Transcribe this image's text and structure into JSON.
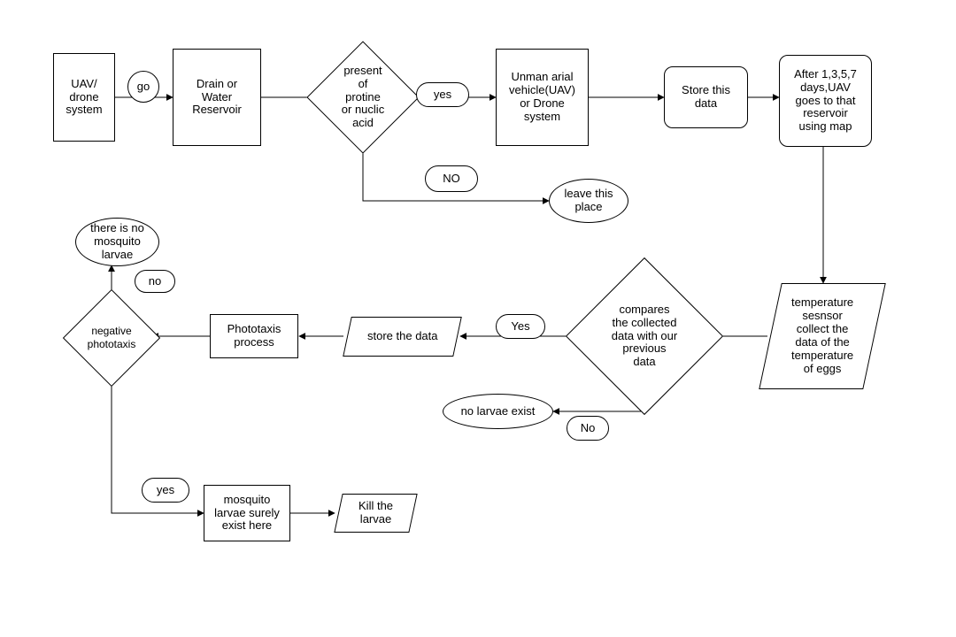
{
  "diagram": {
    "type": "flowchart",
    "nodes": {
      "uav_drone_system": "UAV/\ndrone\nsystem",
      "go": "go",
      "drain": "Drain or\nWater\nReservoir",
      "present_decision": "present\nof\nprotine\nor nuclic\nacid",
      "yes1": "yes",
      "no1": "NO",
      "uav2": "Unman arial\nvehicle(UAV)\nor Drone\nsystem",
      "store1": "Store this\ndata",
      "schedule": "After 1,3,5,7\ndays,UAV\ngoes to that\nreservoir\nusing map",
      "leave": "leave this\nplace",
      "temp_sensor": "temperature\nsesnsor\ncollect the\ndata of the\ntemperature\nof eggs",
      "compare_decision": "compares\nthe collected\ndata with our\nprevious\ndata",
      "yes2": "Yes",
      "no2": "No",
      "no_larvae_exist": "no larvae exist",
      "store2": "store the data",
      "phototaxis_process": "Phototaxis\nprocess",
      "neg_photo": "negative\nphototaxis",
      "no3": "no",
      "no_mosquito": "there is no\nmosquito\nlarvae",
      "yes3": "yes",
      "mosquito_exist": "mosquito\nlarvae surely\nexist here",
      "kill": "Kill the\nlarvae"
    }
  }
}
